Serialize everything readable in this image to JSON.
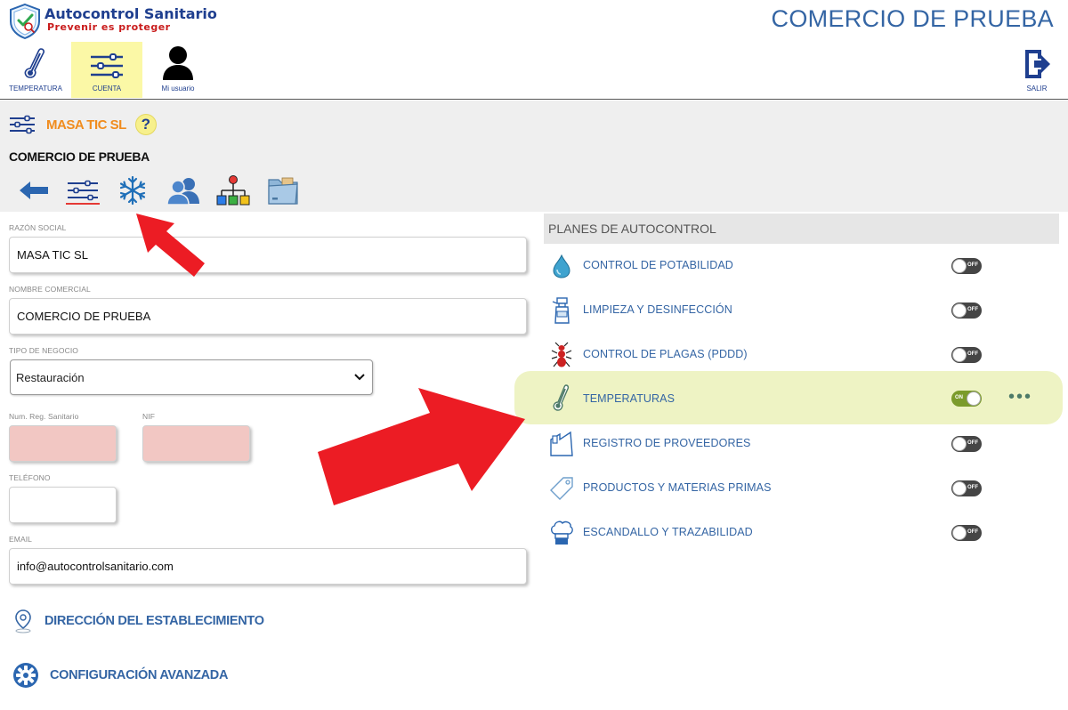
{
  "brand": {
    "name": "Autocontrol Sanitario",
    "slogan": "Prevenir es proteger"
  },
  "header": {
    "business_title": "COMERCIO DE PRUEBA"
  },
  "nav": [
    {
      "id": "temperatura",
      "label": "TEMPERATURA",
      "icon": "thermometer-icon"
    },
    {
      "id": "cuenta",
      "label": "CUENTA",
      "icon": "sliders-icon",
      "active": true
    },
    {
      "id": "usuario",
      "label": "Mi usuario",
      "icon": "user-icon"
    },
    {
      "id": "salir",
      "label": "SALIR",
      "icon": "logout-icon"
    }
  ],
  "account": {
    "company": "MASA TIC SL",
    "help": "?",
    "business": "COMERCIO DE PRUEBA"
  },
  "toolbar_icons": [
    "back-arrow-icon",
    "sliders-icon",
    "snowflake-icon",
    "users-icon",
    "org-chart-icon",
    "folder-icon"
  ],
  "form": {
    "razon_social": {
      "label": "RAZÓN SOCIAL",
      "value": "MASA TIC SL"
    },
    "nombre_comercial": {
      "label": "NOMBRE COMERCIAL",
      "value": "COMERCIO DE PRUEBA"
    },
    "tipo_negocio": {
      "label": "TIPO DE NEGOCIO",
      "value": "Restauración"
    },
    "num_reg_sanitario": {
      "label": "Num. Reg. Sanitario",
      "value": ""
    },
    "nif": {
      "label": "NIF",
      "value": ""
    },
    "telefono": {
      "label": "TELÉFONO",
      "value": ""
    },
    "email": {
      "label": "EMAIL",
      "value": "info@autocontrolsanitario.com"
    }
  },
  "links": {
    "direccion": "DIRECCIÓN DEL ESTABLECIMIENTO",
    "configuracion": "CONFIGURACIÓN AVANZADA"
  },
  "planes": {
    "title": "PLANES DE AUTOCONTROL",
    "items": [
      {
        "label": "CONTROL DE POTABILIDAD",
        "icon": "water-drop-icon",
        "enabled": false,
        "state": "OFF"
      },
      {
        "label": "LIMPIEZA Y DESINFECCIÓN",
        "icon": "spray-bottle-icon",
        "enabled": false,
        "state": "OFF"
      },
      {
        "label": "CONTROL DE PLAGAS (PDDD)",
        "icon": "ant-icon",
        "enabled": false,
        "state": "OFF"
      },
      {
        "label": "TEMPERATURAS",
        "icon": "thermometer-icon",
        "enabled": true,
        "state": "ON",
        "options": "•••"
      },
      {
        "label": "REGISTRO DE PROVEEDORES",
        "icon": "factory-icon",
        "enabled": false,
        "state": "OFF"
      },
      {
        "label": "PRODUCTOS Y MATERIAS PRIMAS",
        "icon": "tag-icon",
        "enabled": false,
        "state": "OFF"
      },
      {
        "label": "ESCANDALLO Y TRAZABILIDAD",
        "icon": "chef-hat-icon",
        "enabled": false,
        "state": "OFF"
      }
    ]
  },
  "colors": {
    "brand_blue": "#1f3f8f",
    "link_blue": "#3465a4",
    "accent_orange": "#f08c1e",
    "highlight": "#eef3c4",
    "arrow_red": "#ec1c24",
    "toggle_on": "#7b9b2b"
  }
}
